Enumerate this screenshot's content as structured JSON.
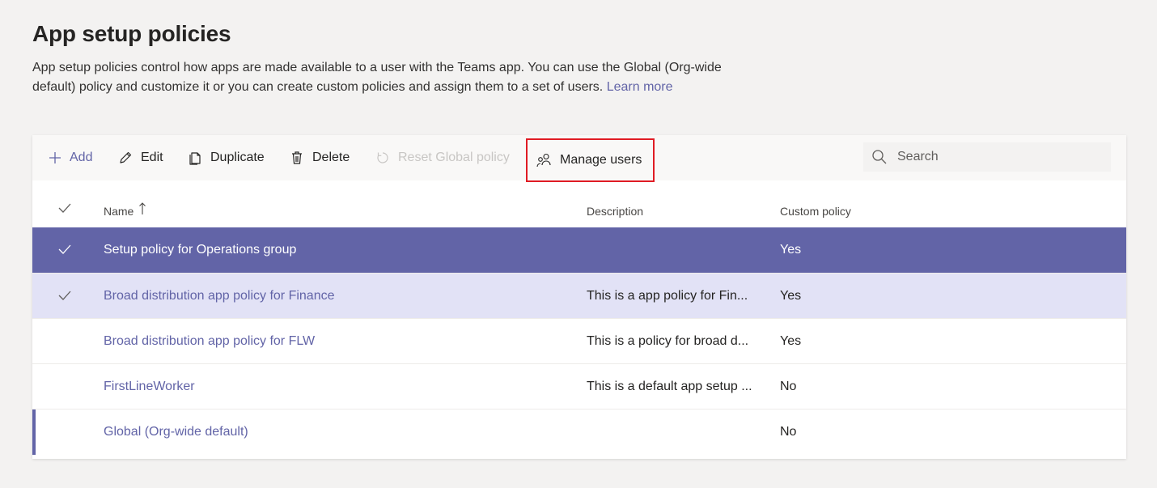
{
  "page": {
    "title": "App setup policies",
    "description": "App setup policies control how apps are made available to a user with the Teams app. You can use the Global (Org-wide default) policy and customize it or you can create custom policies and assign them to a set of users.",
    "learn_more": "Learn more"
  },
  "toolbar": {
    "add": "Add",
    "edit": "Edit",
    "duplicate": "Duplicate",
    "delete": "Delete",
    "reset": "Reset Global policy",
    "manage_users": "Manage users"
  },
  "search": {
    "placeholder": "Search"
  },
  "table": {
    "columns": {
      "name": "Name",
      "description": "Description",
      "custom": "Custom policy"
    },
    "rows": [
      {
        "name": "Setup policy for Operations group",
        "description": "",
        "custom": "Yes",
        "state": "selected"
      },
      {
        "name": "Broad distribution app policy for Finance",
        "description": "This is a app policy for Fin...",
        "custom": "Yes",
        "state": "checked"
      },
      {
        "name": "Broad distribution app policy for FLW",
        "description": "This is a policy for broad d...",
        "custom": "Yes",
        "state": "normal"
      },
      {
        "name": "FirstLineWorker",
        "description": "This is a default app setup ...",
        "custom": "No",
        "state": "normal"
      },
      {
        "name": "Global (Org-wide default)",
        "description": "",
        "custom": "No",
        "state": "marked"
      }
    ]
  },
  "colors": {
    "accent": "#6264a7",
    "selected_row": "#6264a7",
    "checked_row": "#e2e2f6",
    "highlight_border": "#e01b24"
  }
}
